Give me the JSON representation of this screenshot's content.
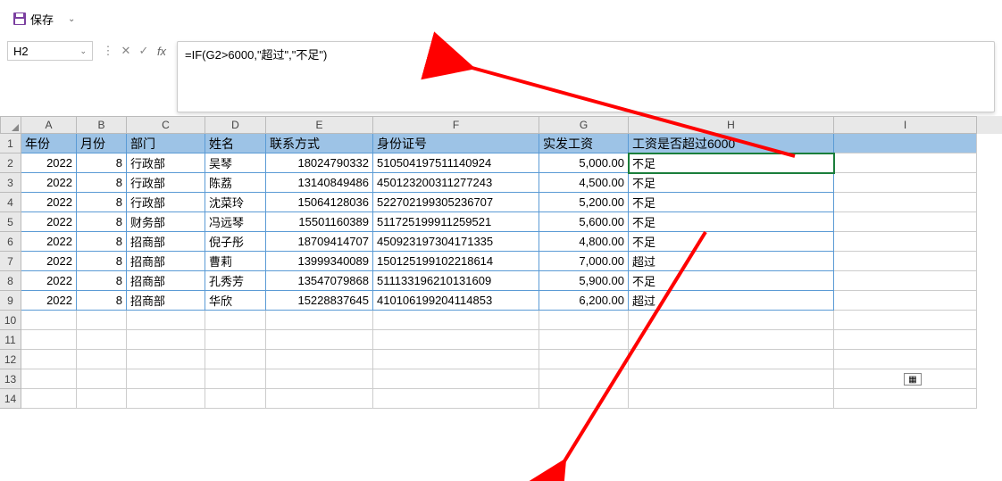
{
  "toolbar": {
    "save_label": "保存"
  },
  "formula_bar": {
    "cell_ref": "H2",
    "formula": "=IF(G2>6000,\"超过\",\"不足\")",
    "fx_label": "fx"
  },
  "columns": [
    "A",
    "B",
    "C",
    "D",
    "E",
    "F",
    "G",
    "H",
    "I"
  ],
  "headers": {
    "A": "年份",
    "B": "月份",
    "C": "部门",
    "D": "姓名",
    "E": "联系方式",
    "F": "身份证号",
    "G": "实发工资",
    "H": "工资是否超过6000"
  },
  "rows": [
    {
      "n": "2",
      "A": "2022",
      "B": "8",
      "C": "行政部",
      "D": "吴琴",
      "E": "18024790332",
      "F": "510504197511140924",
      "G": "5,000.00",
      "H": "不足"
    },
    {
      "n": "3",
      "A": "2022",
      "B": "8",
      "C": "行政部",
      "D": "陈荔",
      "E": "13140849486",
      "F": "450123200311277243",
      "G": "4,500.00",
      "H": "不足"
    },
    {
      "n": "4",
      "A": "2022",
      "B": "8",
      "C": "行政部",
      "D": "沈菜玲",
      "E": "15064128036",
      "F": "522702199305236707",
      "G": "5,200.00",
      "H": "不足"
    },
    {
      "n": "5",
      "A": "2022",
      "B": "8",
      "C": "财务部",
      "D": "冯远琴",
      "E": "15501160389",
      "F": "511725199911259521",
      "G": "5,600.00",
      "H": "不足"
    },
    {
      "n": "6",
      "A": "2022",
      "B": "8",
      "C": "招商部",
      "D": "倪子彤",
      "E": "18709414707",
      "F": "450923197304171335",
      "G": "4,800.00",
      "H": "不足"
    },
    {
      "n": "7",
      "A": "2022",
      "B": "8",
      "C": "招商部",
      "D": "曹莉",
      "E": "13999340089",
      "F": "150125199102218614",
      "G": "7,000.00",
      "H": "超过"
    },
    {
      "n": "8",
      "A": "2022",
      "B": "8",
      "C": "招商部",
      "D": "孔秀芳",
      "E": "13547079868",
      "F": "511133196210131609",
      "G": "5,900.00",
      "H": "不足"
    },
    {
      "n": "9",
      "A": "2022",
      "B": "8",
      "C": "招商部",
      "D": "华欣",
      "E": "15228837645",
      "F": "410106199204114853",
      "G": "6,200.00",
      "H": "超过"
    }
  ],
  "empty_rows": [
    "10",
    "11",
    "12",
    "13",
    "14"
  ]
}
